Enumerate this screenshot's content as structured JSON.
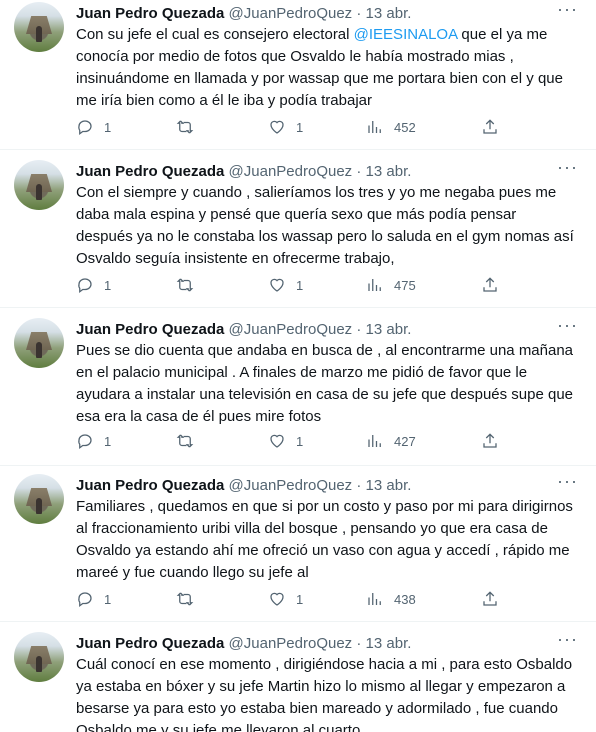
{
  "tweets": [
    {
      "name": "Juan Pedro Quezada",
      "handle": "@JuanPedroQuez",
      "sep": "·",
      "time": "13 abr.",
      "text_before": "Con su jefe el cual es consejero electoral ",
      "mention": "@IEESINALOA",
      "text_after": " que el ya me conocía por medio de fotos que Osvaldo le había mostrado mias , insinuándome en llamada y por wassap que me portara bien con el y que me iría bien como a él le iba y podía trabajar",
      "replies": "1",
      "retweets": "",
      "likes": "1",
      "views": "452"
    },
    {
      "name": "Juan Pedro Quezada",
      "handle": "@JuanPedroQuez",
      "sep": "·",
      "time": "13 abr.",
      "text_before": "Con el siempre y cuando , salieríamos los tres y yo me negaba pues me daba mala espina y pensé que quería sexo que más podía pensar después ya no le constaba los wassap pero lo saluda en el gym nomas así Osvaldo seguía insistente en ofrecerme trabajo,",
      "mention": "",
      "text_after": "",
      "replies": "1",
      "retweets": "",
      "likes": "1",
      "views": "475"
    },
    {
      "name": "Juan Pedro Quezada",
      "handle": "@JuanPedroQuez",
      "sep": "·",
      "time": "13 abr.",
      "text_before": "Pues se dio cuenta que andaba en busca de , al encontrarme una mañana en el palacio municipal . A finales de marzo me pidió de favor que le ayudara a instalar una televisión en casa de su jefe que después supe que esa era la casa de él pues mire fotos",
      "mention": "",
      "text_after": "",
      "replies": "1",
      "retweets": "",
      "likes": "1",
      "views": "427"
    },
    {
      "name": "Juan Pedro Quezada",
      "handle": "@JuanPedroQuez",
      "sep": "·",
      "time": "13 abr.",
      "text_before": "Familiares , quedamos en que si por un costo y paso por mi para dirigirnos al fraccionamiento uribi villa del bosque , pensando yo que era casa de Osvaldo ya estando ahí me ofreció un vaso con agua y accedí , rápido me mareé y fue cuando llego su jefe al",
      "mention": "",
      "text_after": "",
      "replies": "1",
      "retweets": "",
      "likes": "1",
      "views": "438"
    },
    {
      "name": "Juan Pedro Quezada",
      "handle": "@JuanPedroQuez",
      "sep": "·",
      "time": "13 abr.",
      "text_before": "Cuál conocí en ese momento , dirigiéndose hacia a mi , para esto Osbaldo ya estaba en bóxer y su jefe Martin hizo lo mismo al llegar y empezaron a besarse ya para esto yo estaba bien mareado y adormilado , fue cuando Osbaldo me y su jefe me llevaron al cuarto",
      "mention": "",
      "text_after": "",
      "replies": "",
      "retweets": "",
      "likes": "",
      "views": ""
    }
  ],
  "icons": {
    "reply": "reply-icon",
    "retweet": "retweet-icon",
    "like": "heart-icon",
    "views": "views-icon",
    "share": "share-icon",
    "more": "more-icon"
  },
  "colors": {
    "accent": "#1d9bf0",
    "text": "#0f1419",
    "secondary": "#536471",
    "divider": "#eff3f4"
  }
}
